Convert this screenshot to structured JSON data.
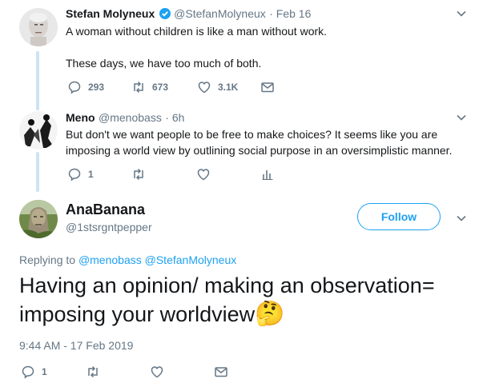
{
  "tweet1": {
    "name": "Stefan Molyneux",
    "handle": "@StefanMolyneux",
    "date": "· Feb 16",
    "line1": "A woman without children is like a man without work.",
    "line2": "These days, we have too much of both.",
    "replies": "293",
    "retweets": "673",
    "likes": "3.1K"
  },
  "tweet2": {
    "name": "Meno",
    "handle": "@menobass",
    "date": "· 6h",
    "line1": "But don't we want people to be free to make choices? It seems like you are",
    "line2": "imposing a world view by outlining social purpose in an oversimplistic manner.",
    "replies": "1"
  },
  "main": {
    "name": "AnaBanana",
    "handle": "@1stsrgntpepper",
    "follow_label": "Follow",
    "replying_prefix": "Replying to",
    "replying_to": "@menobass @StefanMolyneux",
    "text_line1": "Having an opinion/ making an observation=",
    "text_line2": "imposing your worldview",
    "emoji": "🤔",
    "timestamp": "9:44 AM - 17 Feb 2019",
    "replies": "1"
  },
  "colors": {
    "accent": "#1da1f2",
    "muted": "#657786",
    "thread": "#cde3f4"
  }
}
